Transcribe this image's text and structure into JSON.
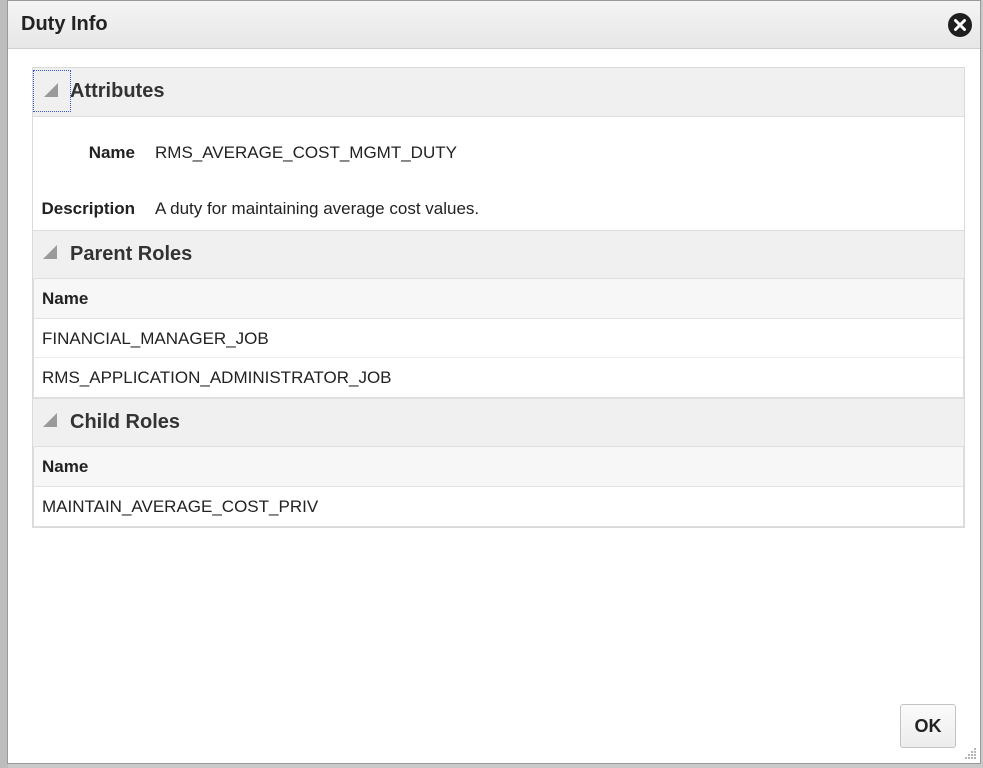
{
  "dialog": {
    "title": "Duty Info",
    "close_icon": "close-circle-icon"
  },
  "attributes": {
    "section_title": "Attributes",
    "name_label": "Name",
    "name_value": "RMS_AVERAGE_COST_MGMT_DUTY",
    "description_label": "Description",
    "description_value": "A duty for maintaining average cost values."
  },
  "parent_roles": {
    "section_title": "Parent Roles",
    "column_header": "Name",
    "rows": [
      "FINANCIAL_MANAGER_JOB",
      "RMS_APPLICATION_ADMINISTRATOR_JOB"
    ]
  },
  "child_roles": {
    "section_title": "Child Roles",
    "column_header": "Name",
    "rows": [
      "MAINTAIN_AVERAGE_COST_PRIV"
    ]
  },
  "footer": {
    "ok_label": "OK"
  },
  "colors": {
    "header_bg": "#f0f0f0",
    "close_button": "#1f1f1f",
    "focus_outline": "#3a55c9"
  }
}
